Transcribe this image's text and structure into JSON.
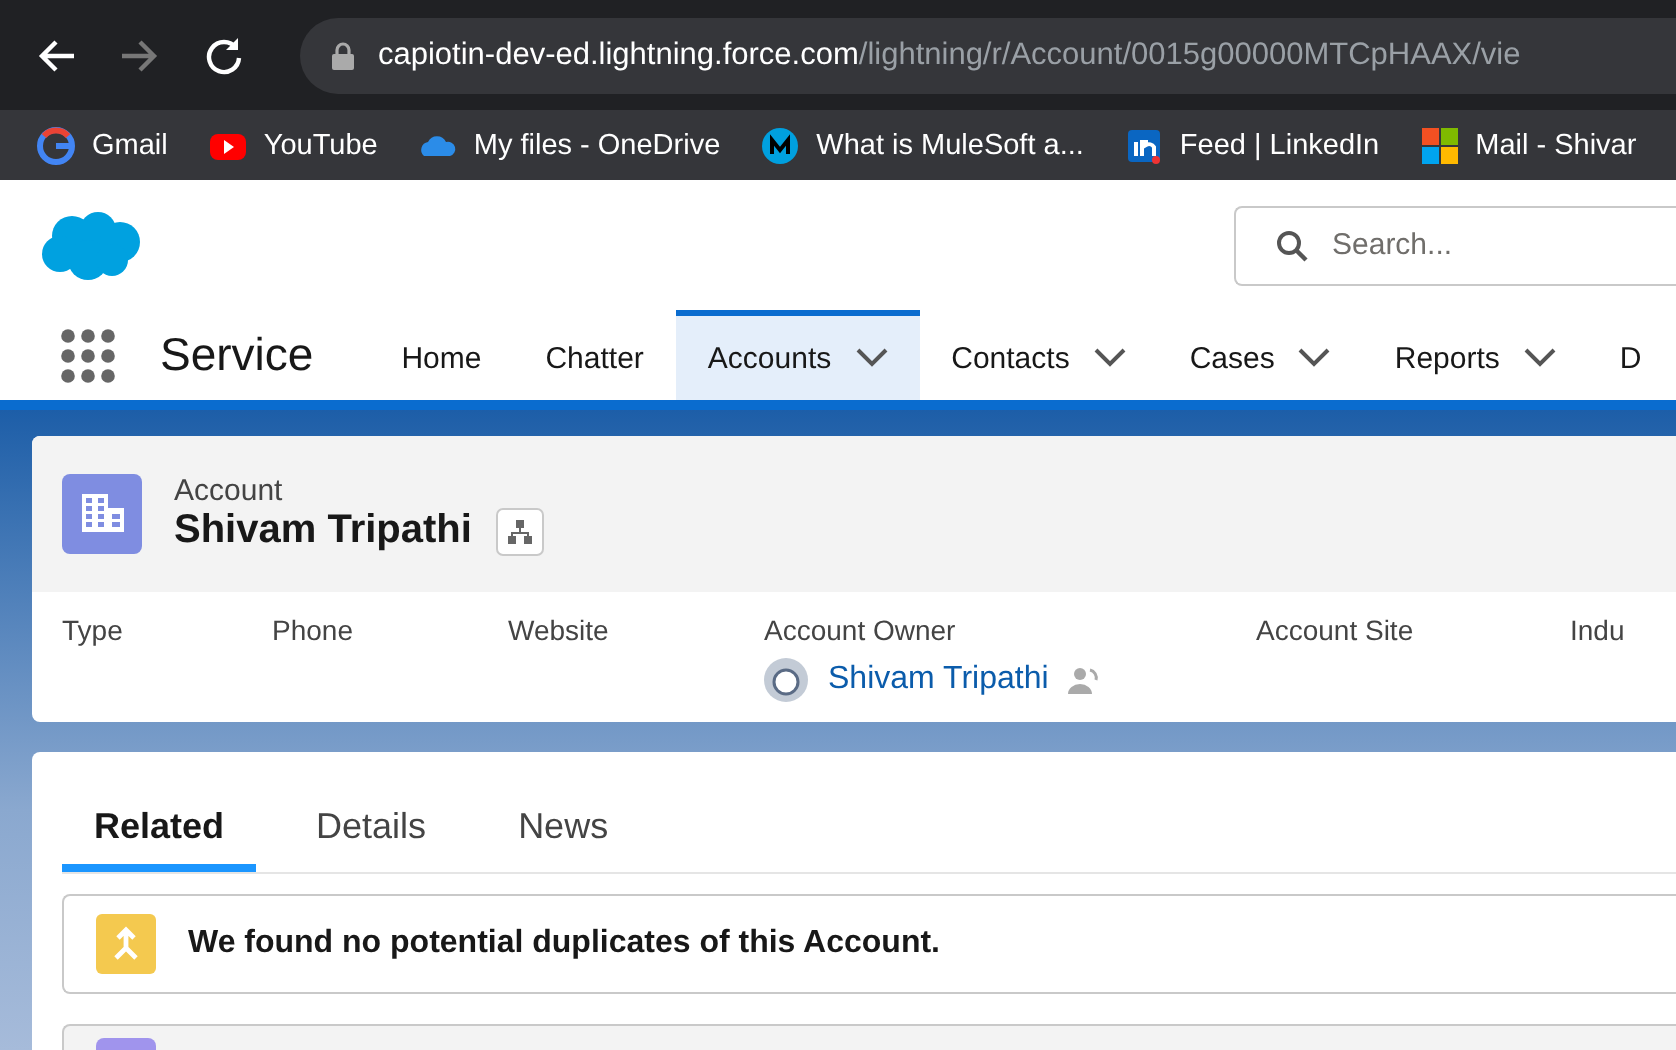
{
  "browser": {
    "url_host": "capiotin-dev-ed.lightning.force.com",
    "url_path": "/lightning/r/Account/0015g00000MTCpHAAX/vie",
    "bookmarks": [
      {
        "label": "Gmail",
        "kind": "g"
      },
      {
        "label": "YouTube",
        "kind": "yt"
      },
      {
        "label": "My files - OneDrive",
        "kind": "cloud"
      },
      {
        "label": "What is MuleSoft a...",
        "kind": "mule"
      },
      {
        "label": "Feed | LinkedIn",
        "kind": "in"
      },
      {
        "label": "Mail - Shivar",
        "kind": "ms"
      }
    ]
  },
  "search": {
    "placeholder": "Search..."
  },
  "app_name": "Service",
  "nav_tabs": [
    {
      "label": "Home",
      "menu": false,
      "selected": false
    },
    {
      "label": "Chatter",
      "menu": false,
      "selected": false
    },
    {
      "label": "Accounts",
      "menu": true,
      "selected": true
    },
    {
      "label": "Contacts",
      "menu": true,
      "selected": false
    },
    {
      "label": "Cases",
      "menu": true,
      "selected": false
    },
    {
      "label": "Reports",
      "menu": true,
      "selected": false
    },
    {
      "label": "D",
      "menu": false,
      "selected": false
    }
  ],
  "record": {
    "object": "Account",
    "name": "Shivam Tripathi",
    "fields": [
      {
        "label": "Type"
      },
      {
        "label": "Phone"
      },
      {
        "label": "Website"
      },
      {
        "label": "Account Owner",
        "value": "Shivam Tripathi"
      },
      {
        "label": "Account Site"
      },
      {
        "label": "Indu"
      }
    ]
  },
  "tabs": [
    {
      "label": "Related",
      "selected": true
    },
    {
      "label": "Details",
      "selected": false
    },
    {
      "label": "News",
      "selected": false
    }
  ],
  "duplicates_message": "We found no potential duplicates of this Account."
}
